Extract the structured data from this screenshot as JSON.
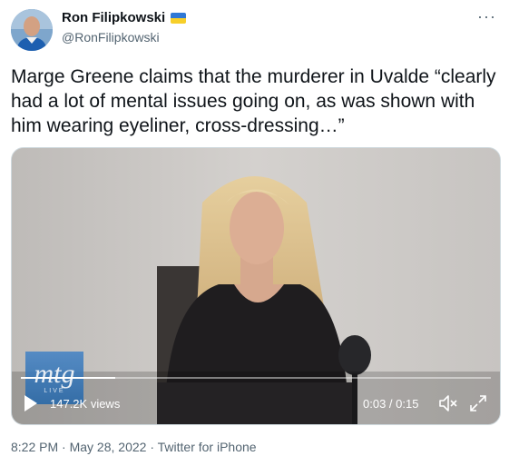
{
  "author": {
    "display_name": "Ron Filipkowski",
    "handle": "@RonFilipkowski",
    "badge": "ukraine-flag-icon"
  },
  "more_icon": "more-horizontal-icon",
  "tweet": {
    "text": "Marge Greene claims that the murderer in Uvalde “clearly had a lot of mental issues going on, as was shown with him wearing eyeliner, cross-dressing…”"
  },
  "video": {
    "logo_text": "mtg",
    "logo_sub": "LIVE",
    "views": "147.2K views",
    "time": "0:03 / 0:15",
    "progress_fraction": 0.2,
    "icons": [
      "play-icon",
      "mute-icon",
      "expand-icon"
    ]
  },
  "meta": {
    "time": "8:22 PM",
    "separator": " · ",
    "date": "May 28, 2022",
    "source": "Twitter for iPhone"
  },
  "colors": {
    "text": "#0f1419",
    "secondary": "#536471",
    "flag_blue": "#2f78d6",
    "flag_yellow": "#f7cf2a"
  }
}
